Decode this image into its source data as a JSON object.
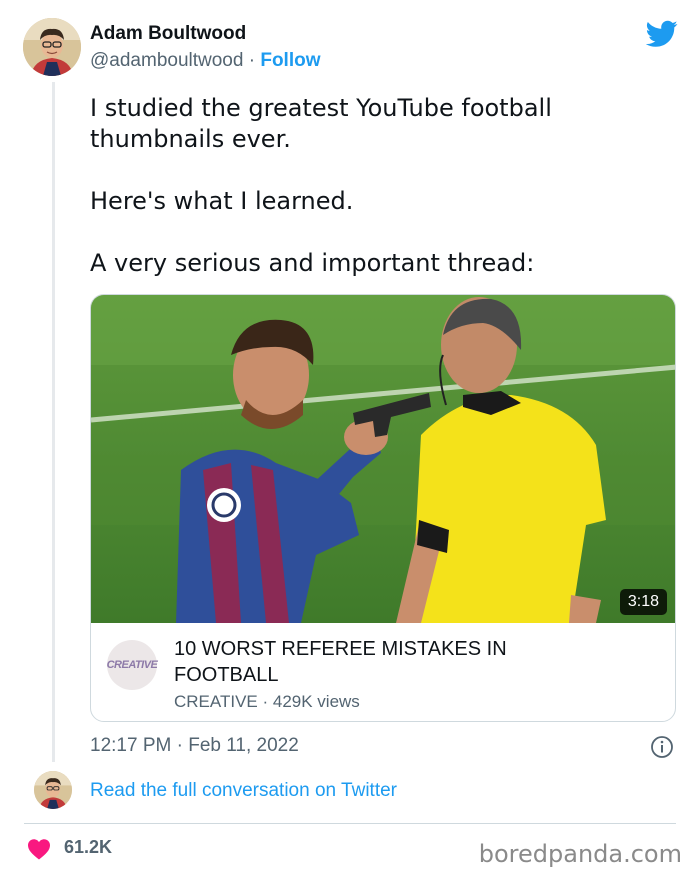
{
  "author": {
    "name": "Adam Boultwood",
    "handle": "@adamboultwood",
    "separator": " · ",
    "follow_label": "Follow"
  },
  "tweet": {
    "paragraphs": [
      "I studied the greatest YouTube football thumbnails ever.",
      "Here's what I learned.",
      "A very serious and important thread:"
    ]
  },
  "video_card": {
    "duration": "3:18",
    "channel_logo_text": "CREATIVE",
    "title": "10 WORST REFEREE MISTAKES IN FOOTBALL",
    "meta": "CREATIVE · 429K views"
  },
  "timestamp": "12:17 PM · Feb 11, 2022",
  "read_full_label": "Read the full conversation on Twitter",
  "likes": "61.2K",
  "watermark": "boredpanda.com",
  "colors": {
    "accent": "#1d9bf0",
    "like": "#f91880",
    "secondary_text": "#536471",
    "border": "#cfd9de"
  },
  "icons": {
    "brand": "twitter-bird-icon",
    "info": "info-icon",
    "like": "heart-icon"
  }
}
